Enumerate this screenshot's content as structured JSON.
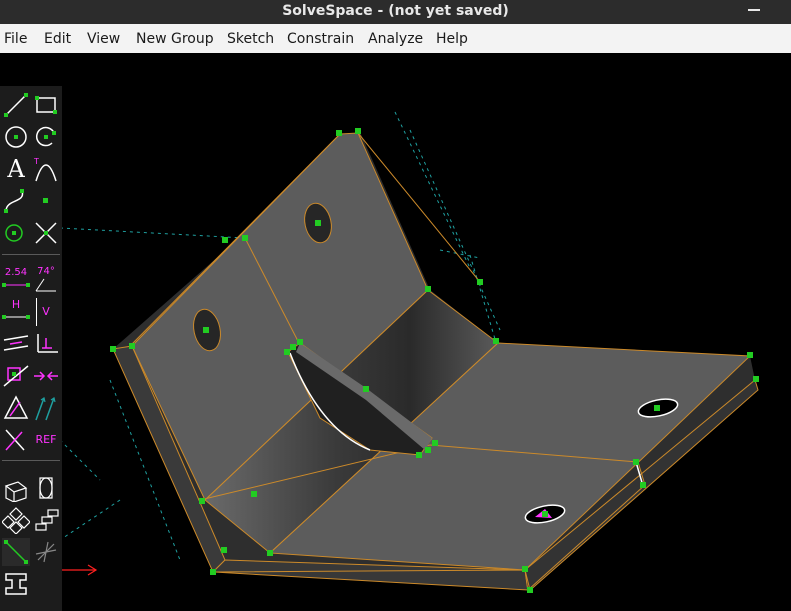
{
  "window": {
    "title": "SolveSpace - (not yet saved)"
  },
  "menu": [
    "File",
    "Edit",
    "View",
    "New Group",
    "Sketch",
    "Constrain",
    "Analyze",
    "Help"
  ],
  "toolbar": {
    "text_tool": "A",
    "dim_label": "2.54",
    "angle_label": "74°",
    "horizontal_label": "H",
    "vertical_label": "V",
    "ref_label": "REF"
  },
  "colors": {
    "background": "#000000",
    "toolbar": "#1c1c1c",
    "sketch_green": "#22cc22",
    "constraint_magenta": "#ff33ff",
    "edge_orange": "#cc8a2a",
    "face_gray": "#5c5c5c",
    "workplane_teal": "#1fa0a0",
    "axis_red": "#ff2020"
  }
}
